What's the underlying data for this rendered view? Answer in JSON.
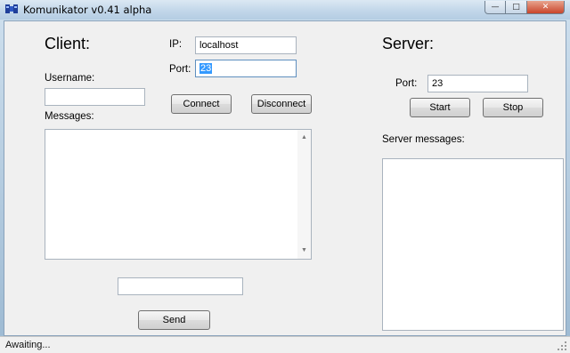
{
  "window": {
    "title": "Komunikator v0.41 alpha",
    "controls": {
      "minimize": "—",
      "maximize": "□",
      "close": "✕"
    }
  },
  "client": {
    "heading": "Client:",
    "ip_label": "IP:",
    "ip_value": "localhost",
    "port_label": "Port:",
    "port_value": "23",
    "username_label": "Username:",
    "username_value": "",
    "connect_label": "Connect",
    "disconnect_label": "Disconnect",
    "messages_label": "Messages:",
    "messages_value": "",
    "message_input_value": "",
    "send_label": "Send"
  },
  "server": {
    "heading": "Server:",
    "port_label": "Port:",
    "port_value": "23",
    "start_label": "Start",
    "stop_label": "Stop",
    "messages_label": "Server messages:",
    "messages_value": ""
  },
  "status": {
    "text": "Awaiting..."
  },
  "icons": {
    "app": "app-icon",
    "scroll_up": "▲",
    "scroll_down": "▼"
  }
}
